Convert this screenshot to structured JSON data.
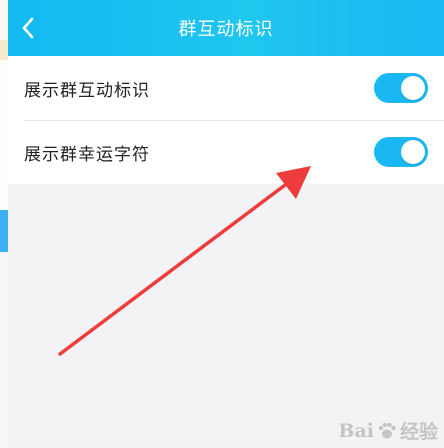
{
  "header": {
    "title": "群互动标识",
    "back_icon": "chevron-left-icon"
  },
  "settings": [
    {
      "label": "展示群互动标识",
      "enabled": true
    },
    {
      "label": "展示群幸运字符",
      "enabled": true
    }
  ],
  "watermark": {
    "text_left": "Bai",
    "text_right": "经验"
  },
  "colors": {
    "header": "#1cc0f0",
    "toggle_on": "#1ab8f3",
    "arrow": "#ee3b3b",
    "background": "#f3f3f6"
  }
}
